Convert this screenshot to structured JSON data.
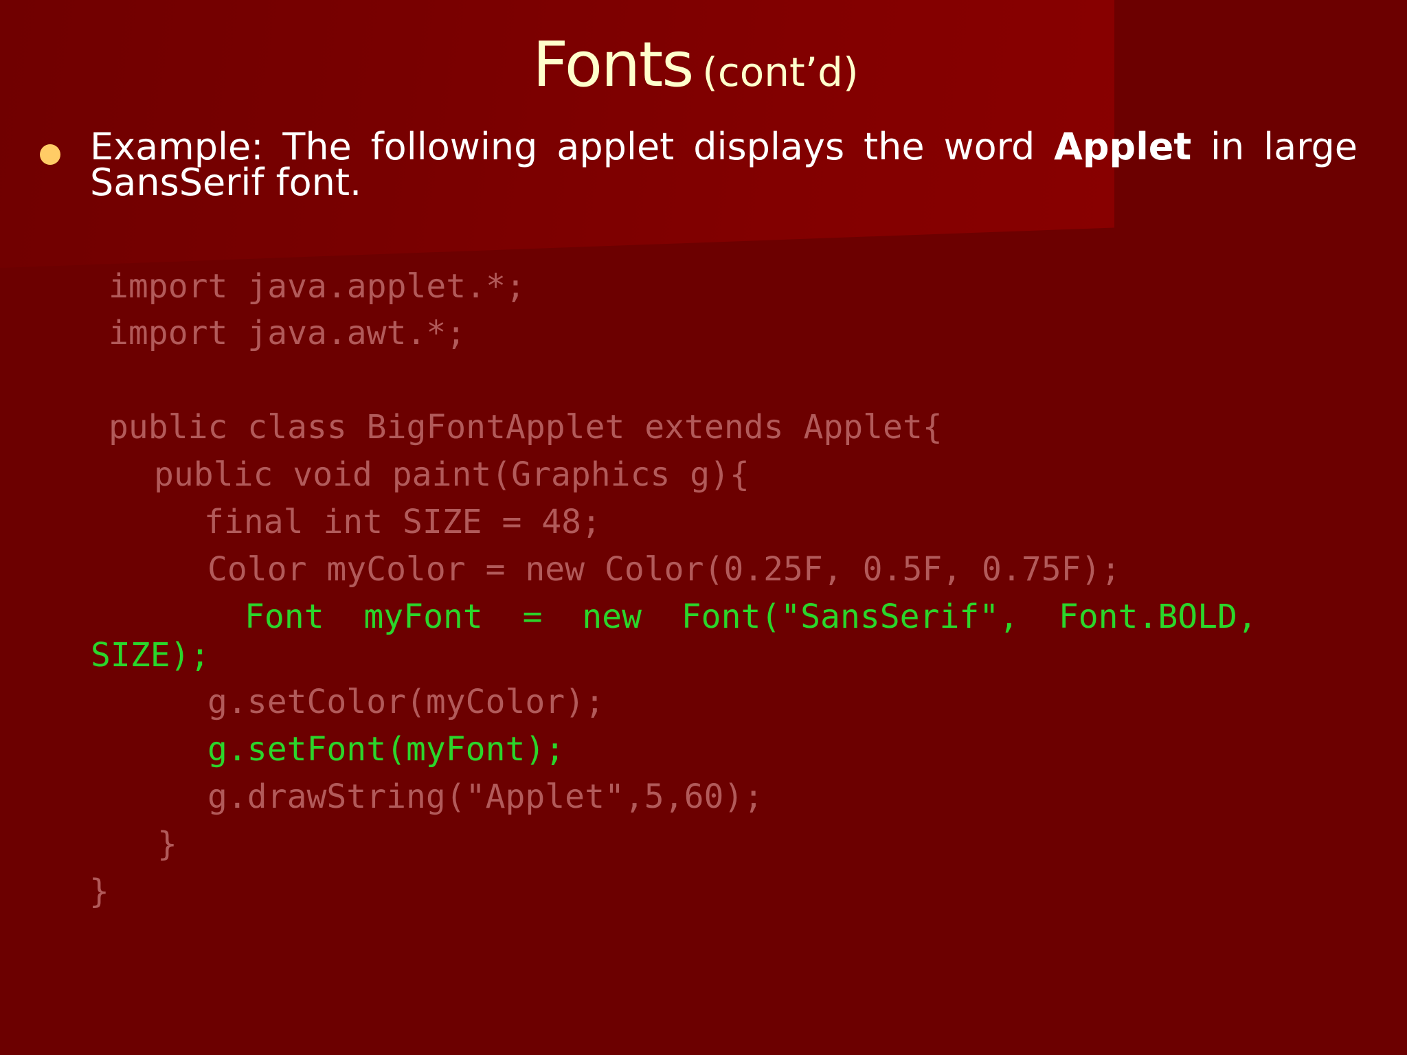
{
  "slide": {
    "title": "Fonts",
    "title_sub": "(cont’d)",
    "bullet": {
      "before": "Example: The following applet displays the word ",
      "bold": "Applet",
      "after": " in large SansSerif font."
    },
    "code_lines": [
      "import java.applet.*;",
      "import java.awt.*;",
      "public class BigFontApplet extends Applet{",
      "public void paint(Graphics g){",
      "final int SIZE = 48;",
      "Color myColor = new Color(0.25F, 0.5F, 0.75F);",
      "Font  myFont  =  new  Font(\"SansSerif\",  Font.BOLD,",
      "SIZE);",
      "g.setColor(myColor);",
      "g.setFont(myFont);",
      "g.drawString(\"Applet\",5,60);",
      "}",
      "}"
    ],
    "colors": {
      "background": "#6c0000",
      "title": "#ffffcc",
      "bullet": "#ffcc66",
      "code": "#b25a5a",
      "highlight": "#2bd62b"
    }
  }
}
